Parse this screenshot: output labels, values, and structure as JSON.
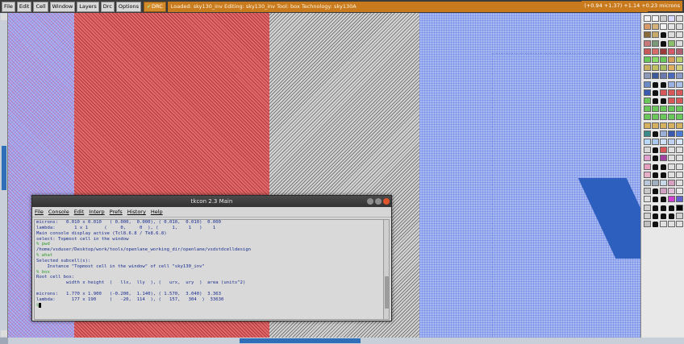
{
  "menubar": {
    "items": [
      "File",
      "Edit",
      "Cell",
      "Window",
      "Layers",
      "Drc",
      "Options"
    ],
    "drc_label": "DRC",
    "status": "Loaded: sky130_inv  Editing: sky130_inv  Tool: box  Technology: sky130A",
    "coords": "(+0.94 +1.37) +1.14 +0.23 microns"
  },
  "colors": {
    "menubar_bg": "#3b3b3b",
    "status_bg": "#c87a1c",
    "red_layer": "#e0696b",
    "gray_layer": "#d4d4d4",
    "blue_layer": "#a8baf2",
    "scroll_thumb": "#2f6fb7"
  },
  "palette": {
    "rows": 30,
    "swatches": [
      [
        "#f2f2f2",
        "#f2f2f2",
        "#cfcfcf",
        "#dcdcff",
        "#dcdcdc"
      ],
      [
        "#d99a6a",
        "#d4b27a",
        "#f2f2f2",
        "#e6e6e6",
        "#dcdcdc"
      ],
      [
        "#8a6b3a",
        "#c8aa6a",
        "#lock",
        "#dcdcdc",
        "#e0e0e0"
      ],
      [
        "#c87a7a",
        "#7a9a7a",
        "#lock",
        "#8cbf6a",
        "#dcdcdc"
      ],
      [
        "#c8585a",
        "#d86a6a",
        "#9a3a3a",
        "#d45a6a",
        "#b06070"
      ],
      [
        "#6ac85a",
        "#8adc6a",
        "#6ac85a",
        "#d4a05a",
        "#b8d06a"
      ],
      [
        "#c8b060",
        "#c0c060",
        "#a8c060",
        "#e0b060",
        "#d0d080"
      ],
      [
        "#8a9ab8",
        "#3a5a9a",
        "#6a7ab0",
        "#4a6ac0",
        "#8a9ac8"
      ],
      [
        "#6a8ac8",
        "#lock",
        "#lock",
        "#9ab0e0",
        "#aac0e8"
      ],
      [
        "#3a5ab0",
        "#lock",
        "#d8585a",
        "#d8585a",
        "#d8585a"
      ],
      [
        "#6ac85a",
        "#lock",
        "#lock",
        "#d8585a",
        "#d8585a"
      ],
      [
        "#6ac85a",
        "#6ac85a",
        "#6ac85a",
        "#6ac85a",
        "#6ac85a"
      ],
      [
        "#6ac85a",
        "#6ac85a",
        "#6ac85a",
        "#6ac85a",
        "#6ac85a"
      ],
      [
        "#d4b060",
        "#d4b060",
        "#d4b060",
        "#d4b060",
        "#d4b060"
      ],
      [
        "#3a8a8a",
        "#lock",
        "#9ab0d8",
        "#3a5ab0",
        "#4a7ad8"
      ],
      [
        "#b8d8f8",
        "#a8c8f0",
        "#d0e0f8",
        "#c0d0f0",
        "#d8e8fa"
      ],
      [
        "#d8d8d8",
        "#lock",
        "#d8585a",
        "#e0e0e0",
        "#e0e0e0"
      ],
      [
        "#e0a0d0",
        "#lock",
        "#a040a0",
        "#e0e0e0",
        "#e0e0e0"
      ],
      [
        "#e8a0c0",
        "#lock",
        "#lock",
        "#e0e0e0",
        "#e0e0e0"
      ],
      [
        "#e8b0c8",
        "#lock",
        "#lock",
        "#e0e0e0",
        "#e0e0e0"
      ],
      [
        "#b8c8d8",
        "#a0b0c0",
        "#c8d8e8",
        "#d8a0c0",
        "#e0e0e0"
      ],
      [
        "#c8c8c8",
        "#lock",
        "#d0a0c0",
        "#e0c0d8",
        "#e8e8e8"
      ],
      [
        "#e0e0e0",
        "#lock",
        "#lock",
        "#d040d0",
        "#6060d0"
      ],
      [
        "#d0d0d0",
        "#lock",
        "#lock",
        "#lock",
        "#000000"
      ],
      [
        "#d0d0d0",
        "#lock",
        "#lock",
        "#lock",
        "#d0d0d0"
      ],
      [
        "#c0c0c0",
        "#lock",
        "#e0e0e0",
        "#e0e0e0",
        "#e0e0e0"
      ]
    ]
  },
  "tkcon": {
    "title": "tkcon 2.3 Main",
    "menu": [
      "File",
      "Console",
      "Edit",
      "Interp",
      "Prefs",
      "History",
      "Help"
    ],
    "lines": [
      {
        "kind": "out",
        "text": "microns:   0.010 x 0.010   ( 0.000,  0.000), ( 0.010,  0.010)  0.000"
      },
      {
        "kind": "out",
        "text": "lambda:       1 x 1      (     0,     0  ), (     1,    1   )    1"
      },
      {
        "kind": "out",
        "text": "Main console display active (Tcl8.6.8 / Tk8.6.8)"
      },
      {
        "kind": "out",
        "text": "select: Topmost cell in the window"
      },
      {
        "kind": "cmd",
        "text": "% pwd"
      },
      {
        "kind": "out",
        "text": "/home/vsduser/Desktop/work/tools/openlane_working_dir/openlane/vsdstdcelldesign"
      },
      {
        "kind": "cmd",
        "text": "% what"
      },
      {
        "kind": "out",
        "text": "Selected subcell(s):"
      },
      {
        "kind": "out",
        "text": "    Instance \"Topmost cell in the window\" of cell \"sky130_inv\""
      },
      {
        "kind": "cmd",
        "text": "% box"
      },
      {
        "kind": "out",
        "text": "Root cell box:"
      },
      {
        "kind": "out",
        "text": "           width x height  (   llx,  lly  ), (   urx,  ury  )  area (units^2)"
      },
      {
        "kind": "blank",
        "text": ""
      },
      {
        "kind": "out",
        "text": "microns:   1.770 x 1.900   (-0.200,  1.140), ( 1.570,  3.040)  3.363"
      },
      {
        "kind": "out",
        "text": "lambda:      177 x 190     (   -20,  114  ), (   157,   304  )  33630"
      }
    ],
    "prompt": "%"
  }
}
